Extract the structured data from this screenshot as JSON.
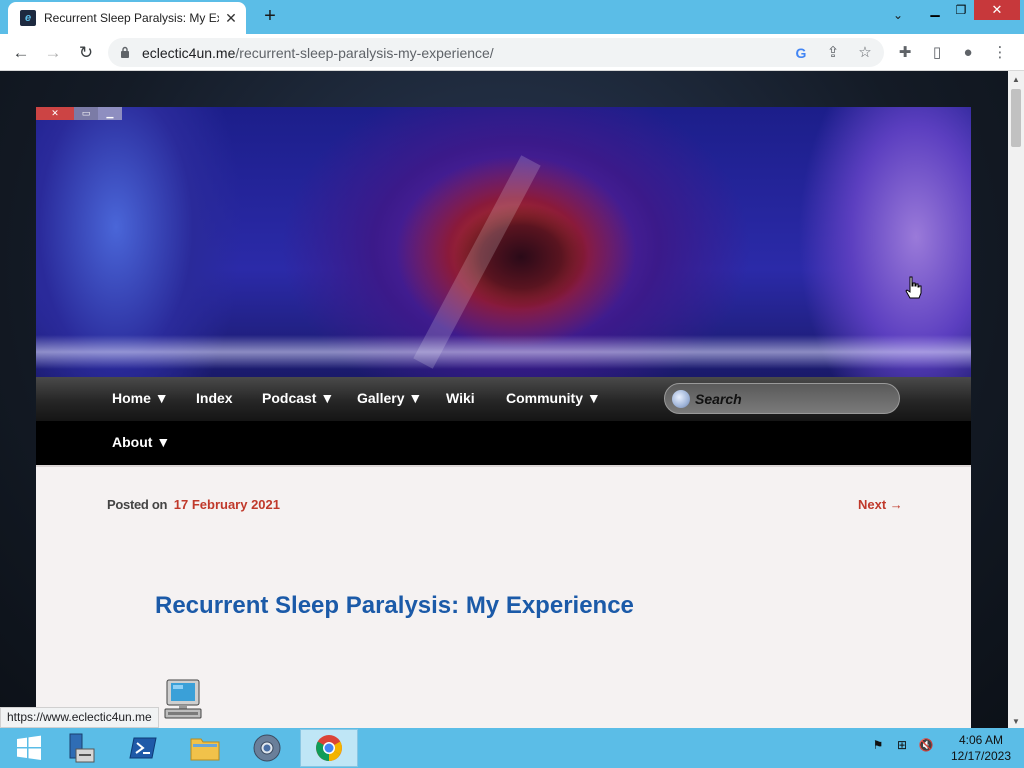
{
  "browser": {
    "tab_title": "Recurrent Sleep Paralysis: My Exp",
    "tab_favicon": "eclectic-logo-icon",
    "url_host": "eclectic4un.me",
    "url_path": "/recurrent-sleep-paralysis-my-experience/",
    "status_url": "https://www.eclectic4un.me"
  },
  "site": {
    "nav": {
      "home": "Home ▼",
      "index": "Index",
      "podcast": "Podcast ▼",
      "gallery": "Gallery ▼",
      "wiki": "Wiki",
      "community": "Community ▼",
      "about": "About ▼"
    },
    "search_placeholder": "Search",
    "post": {
      "posted_label": "Posted on",
      "date": "17 February 2021",
      "next": "Next →",
      "title": "Recurrent Sleep Paralysis: My Experience"
    }
  },
  "taskbar": {
    "time": "4:06 AM",
    "date": "12/17/2023"
  },
  "colors": {
    "taskbar": "#5bbde7",
    "link_red": "#c0392b",
    "title_blue": "#1b5aa8"
  }
}
